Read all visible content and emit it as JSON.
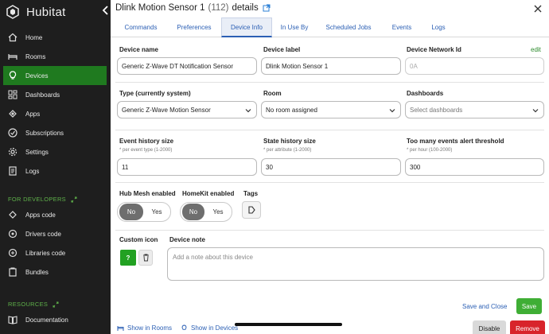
{
  "app": {
    "name": "Hubitat",
    "accent": "#1f7a1f"
  },
  "sidebar": {
    "items": [
      {
        "label": "Home",
        "icon": "home-icon"
      },
      {
        "label": "Rooms",
        "icon": "bed-icon"
      },
      {
        "label": "Devices",
        "icon": "bulb-icon",
        "active": true
      },
      {
        "label": "Dashboards",
        "icon": "dashboard-icon"
      },
      {
        "label": "Apps",
        "icon": "apps-icon"
      },
      {
        "label": "Subscriptions",
        "icon": "check-circle-icon"
      },
      {
        "label": "Settings",
        "icon": "gear-icon"
      },
      {
        "label": "Logs",
        "icon": "logs-icon"
      }
    ],
    "developers_heading": "FOR DEVELOPERS",
    "developer_items": [
      {
        "label": "Apps code",
        "icon": "code-apps-icon"
      },
      {
        "label": "Drivers code",
        "icon": "drivers-icon"
      },
      {
        "label": "Libraries code",
        "icon": "libraries-icon"
      },
      {
        "label": "Bundles",
        "icon": "bundles-icon"
      }
    ],
    "resources_heading": "RESOURCES",
    "resource_items": [
      {
        "label": "Documentation",
        "icon": "book-icon"
      }
    ]
  },
  "header": {
    "title": "Dlink Motion Sensor 1",
    "count": "(112)",
    "suffix": "details"
  },
  "tabs": [
    {
      "label": "Commands"
    },
    {
      "label": "Preferences"
    },
    {
      "label": "Device Info",
      "active": true
    },
    {
      "label": "In Use By"
    },
    {
      "label": "Scheduled Jobs"
    },
    {
      "label": "Events"
    },
    {
      "label": "Logs"
    }
  ],
  "form": {
    "device_name": {
      "label": "Device name",
      "value": "Generic Z-Wave DT Notification Sensor"
    },
    "device_label": {
      "label": "Device label",
      "value": "Dlink Motion Sensor 1"
    },
    "network_id": {
      "label": "Device Network Id",
      "value": "0A",
      "edit": "edit"
    },
    "type": {
      "label": "Type (currently system)",
      "value": "Generic Z-Wave Motion Sensor"
    },
    "room": {
      "label": "Room",
      "value": "No room assigned"
    },
    "dashboards": {
      "label": "Dashboards",
      "placeholder": "Select dashboards"
    },
    "event_history": {
      "label": "Event history size",
      "hint": "* per event type (1-2000)",
      "value": "11"
    },
    "state_history": {
      "label": "State history size",
      "hint": "* per attribute (1-2000)",
      "value": "30"
    },
    "alert_threshold": {
      "label": "Too many events alert threshold",
      "hint": "* per hour (100-2000)",
      "value": "300"
    },
    "hub_mesh": {
      "label": "Hub Mesh enabled",
      "on": "No",
      "off": "Yes"
    },
    "homekit": {
      "label": "HomeKit enabled",
      "on": "No",
      "off": "Yes"
    },
    "tags": {
      "label": "Tags"
    },
    "custom_icon": {
      "label": "Custom icon",
      "glyph": "?"
    },
    "device_note": {
      "label": "Device note",
      "placeholder": "Add a note about this device"
    }
  },
  "actions": {
    "save_close": "Save and Close",
    "save": "Save",
    "disable": "Disable",
    "remove": "Remove",
    "show_rooms": "Show in Rooms",
    "show_devices": "Show in Devices"
  }
}
